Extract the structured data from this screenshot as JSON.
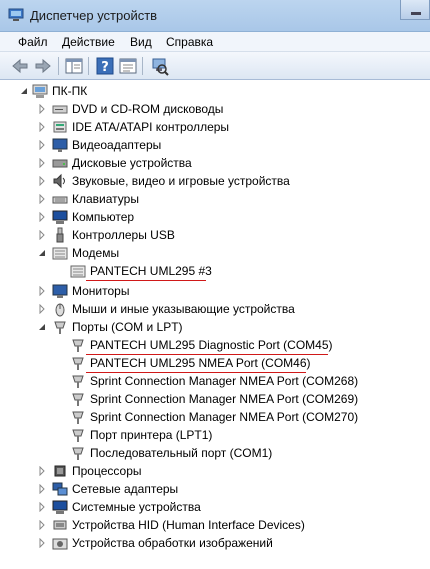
{
  "window": {
    "title": "Диспетчер устройств"
  },
  "menu": {
    "file": "Файл",
    "action": "Действие",
    "view": "Вид",
    "help": "Справка"
  },
  "toolbar": {
    "icons": [
      "back-arrow-icon",
      "forward-arrow-icon",
      "console-tree-icon",
      "help-icon",
      "properties-icon",
      "scan-hardware-icon"
    ]
  },
  "tree": {
    "root": "ПК-ПК",
    "items": [
      {
        "label": "DVD и CD-ROM дисководы",
        "icon": "dvd-drive-icon"
      },
      {
        "label": "IDE ATA/ATAPI контроллеры",
        "icon": "ide-controller-icon"
      },
      {
        "label": "Видеоадаптеры",
        "icon": "display-adapter-icon"
      },
      {
        "label": "Дисковые устройства",
        "icon": "disk-drive-icon"
      },
      {
        "label": "Звуковые, видео и игровые устройства",
        "icon": "sound-icon"
      },
      {
        "label": "Клавиатуры",
        "icon": "keyboard-icon"
      },
      {
        "label": "Компьютер",
        "icon": "computer-icon"
      },
      {
        "label": "Контроллеры USB",
        "icon": "usb-icon"
      },
      {
        "label": "Модемы",
        "icon": "modem-icon"
      },
      {
        "label": "PANTECH UML295 #3",
        "icon": "modem-icon"
      },
      {
        "label": "Мониторы",
        "icon": "monitor-icon"
      },
      {
        "label": "Мыши и иные указывающие устройства",
        "icon": "mouse-icon"
      },
      {
        "label": "Порты (COM и LPT)",
        "icon": "port-icon"
      },
      {
        "label": "PANTECH UML295 Diagnostic Port (COM45)",
        "icon": "port-icon"
      },
      {
        "label": "PANTECH UML295 NMEA Port (COM46)",
        "icon": "port-icon"
      },
      {
        "label": "Sprint Connection Manager NMEA Port (COM268)",
        "icon": "port-icon"
      },
      {
        "label": "Sprint Connection Manager NMEA Port (COM269)",
        "icon": "port-icon"
      },
      {
        "label": "Sprint Connection Manager NMEA Port (COM270)",
        "icon": "port-icon"
      },
      {
        "label": "Порт принтера (LPT1)",
        "icon": "port-icon"
      },
      {
        "label": "Последовательный порт (COM1)",
        "icon": "port-icon"
      },
      {
        "label": "Процессоры",
        "icon": "processor-icon"
      },
      {
        "label": "Сетевые адаптеры",
        "icon": "network-adapter-icon"
      },
      {
        "label": "Системные устройства",
        "icon": "system-device-icon"
      },
      {
        "label": "Устройства HID (Human Interface Devices)",
        "icon": "hid-icon"
      },
      {
        "label": "Устройства обработки изображений",
        "icon": "imaging-device-icon"
      }
    ]
  },
  "colors": {
    "highlight_underline": "#d01818",
    "titlebar": "#b3cfee"
  }
}
